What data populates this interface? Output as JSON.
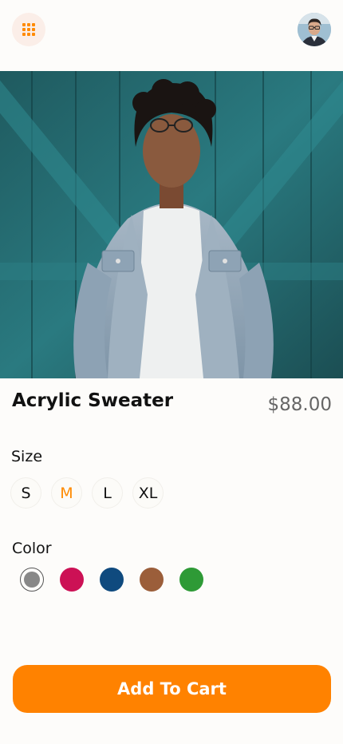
{
  "header": {
    "menu_icon": "grid-menu-icon",
    "avatar_icon": "user-avatar"
  },
  "product": {
    "image": "man-in-denim-jacket-photo",
    "title": "Acrylic Sweater",
    "price": "$88.00"
  },
  "size": {
    "label": "Size",
    "options": [
      "S",
      "M",
      "L",
      "XL"
    ],
    "selected": "M"
  },
  "color": {
    "label": "Color",
    "options": [
      "#888888",
      "#cc1155",
      "#0f4a7e",
      "#9b5e3a",
      "#2e9a36"
    ],
    "selected": "#888888"
  },
  "actions": {
    "add_to_cart_label": "Add To Cart"
  },
  "accent": "#ff8200"
}
